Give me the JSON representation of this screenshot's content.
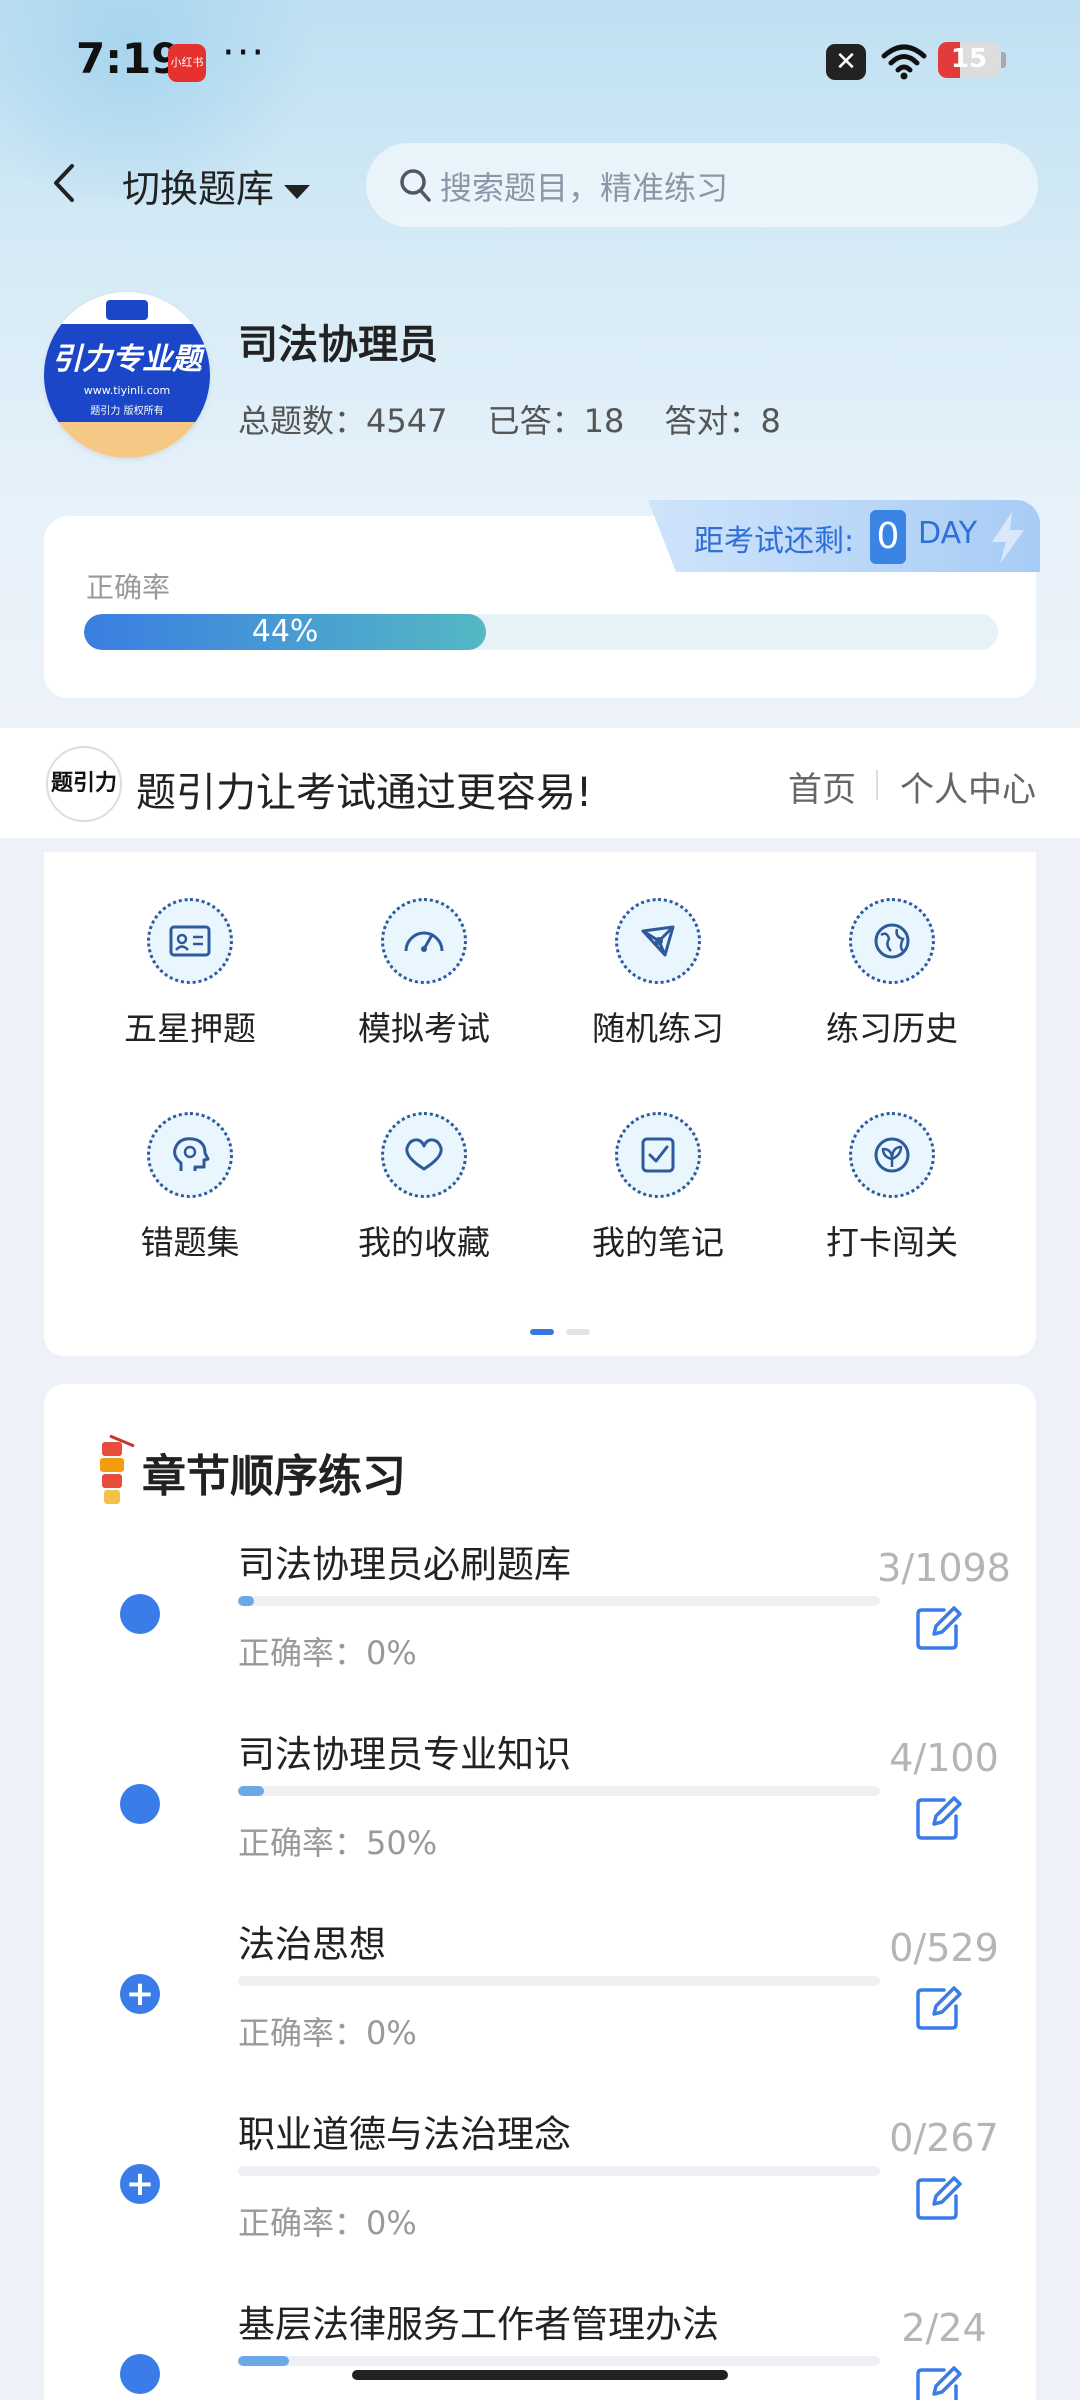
{
  "status_bar": {
    "time": "7:19",
    "app_badge": "小红书",
    "more": "···",
    "battery": "15"
  },
  "header": {
    "back_label": "back",
    "switch_label": "切换题库",
    "search_placeholder": "搜索题目，精准练习"
  },
  "bank": {
    "logo_text": "引力专业题",
    "logo_url": "www.tiyinli.com",
    "logo_copyright": "题引力 版权所有",
    "name": "司法协理员",
    "total": "总题数：4547",
    "answered": "已答：18",
    "correct": "答对：8"
  },
  "countdown": {
    "label": "距考试还剩:",
    "days": "0",
    "unit": "DAY"
  },
  "accuracy": {
    "label": "正确率",
    "percent_text": "44%",
    "value": 0.44
  },
  "banner": {
    "mark": "题引力",
    "slogan": "题引力让考试通过更容易!",
    "nav_home": "首页",
    "nav_me": "个人中心"
  },
  "grid": [
    {
      "label": "五星押题",
      "icon": "id-card-icon"
    },
    {
      "label": "模拟考试",
      "icon": "gauge-icon"
    },
    {
      "label": "随机练习",
      "icon": "network-icon"
    },
    {
      "label": "练习历史",
      "icon": "globe-icon"
    },
    {
      "label": "错题集",
      "icon": "head-icon"
    },
    {
      "label": "我的收藏",
      "icon": "heart-icon"
    },
    {
      "label": "我的笔记",
      "icon": "note-check-icon"
    },
    {
      "label": "打卡闯关",
      "icon": "leaf-icon"
    }
  ],
  "chapters": {
    "title": "章节顺序练习",
    "items": [
      {
        "name": "司法协理员必刷题库",
        "rate": "正确率：0%",
        "count": "3/1098",
        "progress": 0.003,
        "marker": "dot"
      },
      {
        "name": "司法协理员专业知识",
        "rate": "正确率：50%",
        "count": "4/100",
        "progress": 0.04,
        "marker": "dot"
      },
      {
        "name": "法治思想",
        "rate": "正确率：0%",
        "count": "0/529",
        "progress": 0,
        "marker": "plus"
      },
      {
        "name": "职业道德与法治理念",
        "rate": "正确率：0%",
        "count": "0/267",
        "progress": 0,
        "marker": "plus"
      },
      {
        "name": "基层法律服务工作者管理办法",
        "rate": "",
        "count": "2/24",
        "progress": 0.08,
        "marker": "dot"
      }
    ]
  },
  "colors": {
    "accent": "#3a7ce8",
    "teal": "#55b8c4",
    "muted": "#999999"
  }
}
